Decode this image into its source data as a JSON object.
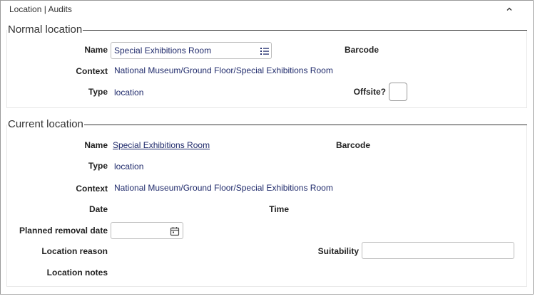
{
  "header": {
    "title": "Location | Audits"
  },
  "normal": {
    "legend": "Normal location",
    "name_label": "Name",
    "name_value": "Special Exhibitions Room",
    "barcode_label": "Barcode",
    "context_label": "Context",
    "context_value": "National Museum/Ground Floor/Special Exhibitions Room",
    "type_label": "Type",
    "type_value": "location",
    "offsite_label": "Offsite?"
  },
  "current": {
    "legend": "Current location",
    "name_label": "Name",
    "name_value": "Special Exhibitions Room",
    "barcode_label": "Barcode",
    "type_label": "Type",
    "type_value": "location",
    "context_label": "Context",
    "context_value": "National Museum/Ground Floor/Special Exhibitions Room",
    "date_label": "Date",
    "time_label": "Time",
    "planned_removal_label": "Planned removal date",
    "planned_removal_value": "",
    "location_reason_label": "Location reason",
    "suitability_label": "Suitability",
    "suitability_value": "",
    "location_notes_label": "Location notes"
  },
  "icons": {
    "collapse": "chevron-up-icon",
    "picker": "list-icon",
    "calendar": "calendar-icon"
  },
  "colors": {
    "value_text": "#1f2a6b",
    "border": "#9a9a9a"
  }
}
